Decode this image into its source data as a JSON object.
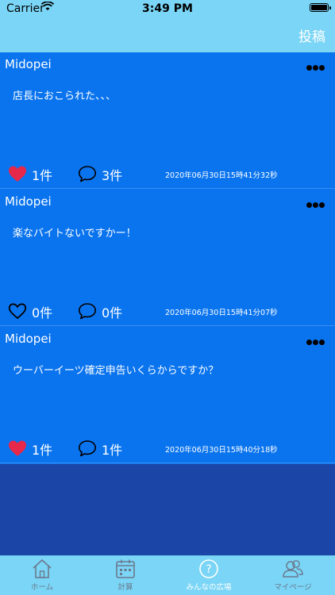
{
  "status": {
    "carrier": "Carrier",
    "time": "3:49 PM"
  },
  "nav": {
    "post_label": "投稿"
  },
  "posts": [
    {
      "user": "Midopei",
      "body": "店長におこられた、、、",
      "likes": "1件",
      "comments": "3件",
      "date": "2020年06月30日15時41分32秒",
      "liked": true
    },
    {
      "user": "Midopei",
      "body": "楽なバイトないですかー！",
      "likes": "0件",
      "comments": "0件",
      "date": "2020年06月30日15時41分07秒",
      "liked": false
    },
    {
      "user": "Midopei",
      "body": "ウーバーイーツ確定申告いくらからですか？",
      "likes": "1件",
      "comments": "1件",
      "date": "2020年06月30日15時40分18秒",
      "liked": true
    }
  ],
  "tabs": [
    {
      "label": "ホーム",
      "icon": "home-icon"
    },
    {
      "label": "計算",
      "icon": "calendar-icon"
    },
    {
      "label": "みんなの広場",
      "icon": "question-icon"
    },
    {
      "label": "マイページ",
      "icon": "people-icon"
    }
  ],
  "colors": {
    "accent": "#7ad5f6",
    "feed": "#0a74ef",
    "background": "#1b45a6",
    "heart": "#e6284a"
  }
}
